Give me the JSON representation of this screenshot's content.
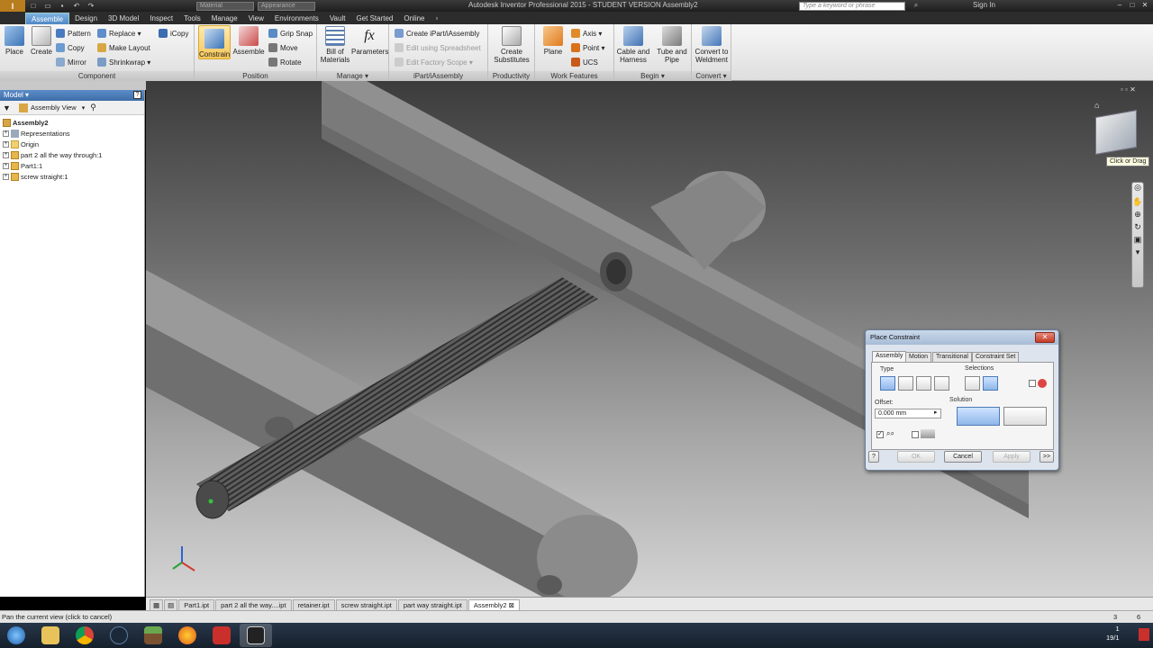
{
  "titlebar": {
    "title": "Autodesk Inventor Professional 2015 - STUDENT VERSION   Assembly2",
    "material_combo": "Material",
    "appearance_combo": "Appearance",
    "search_placeholder": "Type a keyword or phrase",
    "signin": "Sign In"
  },
  "tabs": [
    "Assemble",
    "Design",
    "3D Model",
    "Inspect",
    "Tools",
    "Manage",
    "View",
    "Environments",
    "Vault",
    "Get Started",
    "Online"
  ],
  "ribbon": {
    "component": {
      "title": "Component",
      "place": "Place",
      "create": "Create",
      "pattern": "Pattern",
      "copy": "Copy",
      "mirror": "Mirror",
      "replace": "Replace",
      "make_layout": "Make Layout",
      "shrinkwrap": "Shrinkwrap",
      "icopy": "iCopy"
    },
    "position": {
      "title": "Position",
      "constrain": "Constrain",
      "assemble": "Assemble",
      "grip_snap": "Grip Snap",
      "move": "Move",
      "rotate": "Rotate"
    },
    "manage": {
      "title": "Manage",
      "bom_line1": "Bill of",
      "bom_line2": "Materials",
      "parameters": "Parameters"
    },
    "ipart": {
      "title": "iPart/iAssembly",
      "create": "Create iPart/iAssembly",
      "edit_spreadsheet": "Edit using Spreadsheet",
      "edit_scope": "Edit Factory Scope"
    },
    "productivity": {
      "title": "Productivity",
      "line1": "Create",
      "line2": "Substitutes"
    },
    "work_features": {
      "title": "Work Features",
      "plane": "Plane",
      "axis": "Axis",
      "point": "Point",
      "ucs": "UCS"
    },
    "begin": {
      "title": "Begin",
      "cable_line1": "Cable and",
      "cable_line2": "Harness",
      "tube_line1": "Tube and",
      "tube_line2": "Pipe"
    },
    "convert": {
      "title": "Convert",
      "line1": "Convert to",
      "line2": "Weldment"
    }
  },
  "browser": {
    "header": "Model",
    "view_combo": "Assembly View",
    "items": [
      {
        "label": "Assembly2",
        "bold": true
      },
      {
        "label": "Representations"
      },
      {
        "label": "Origin"
      },
      {
        "label": "part 2 all the way through:1"
      },
      {
        "label": "Part1:1"
      },
      {
        "label": "screw straight:1"
      }
    ]
  },
  "viewcube": {
    "tooltip": "Click or Drag"
  },
  "doc_tabs": [
    "Part1.ipt",
    "part 2 all the way....ipt",
    "retainer.ipt",
    "screw straight.ipt",
    "part way straight.ipt",
    "Assembly2"
  ],
  "status": {
    "text": "Pan the current view (click to cancel)",
    "num1": "3",
    "num2": "6"
  },
  "dialog": {
    "title": "Place Constraint",
    "tabs": [
      "Assembly",
      "Motion",
      "Transitional",
      "Constraint Set"
    ],
    "type_label": "Type",
    "selections_label": "Selections",
    "offset_label": "Offset:",
    "offset_value": "0.000 mm",
    "solution_label": "Solution",
    "ok": "OK",
    "cancel": "Cancel",
    "apply": "Apply",
    "more": ">>"
  },
  "taskbar": {
    "clock_time": "1",
    "clock_date": "19/1"
  },
  "colors": {
    "ribbon_tab_active": "#4f87c4",
    "highlight": "#f6c75a",
    "part_grey": "#8a8a8a"
  }
}
